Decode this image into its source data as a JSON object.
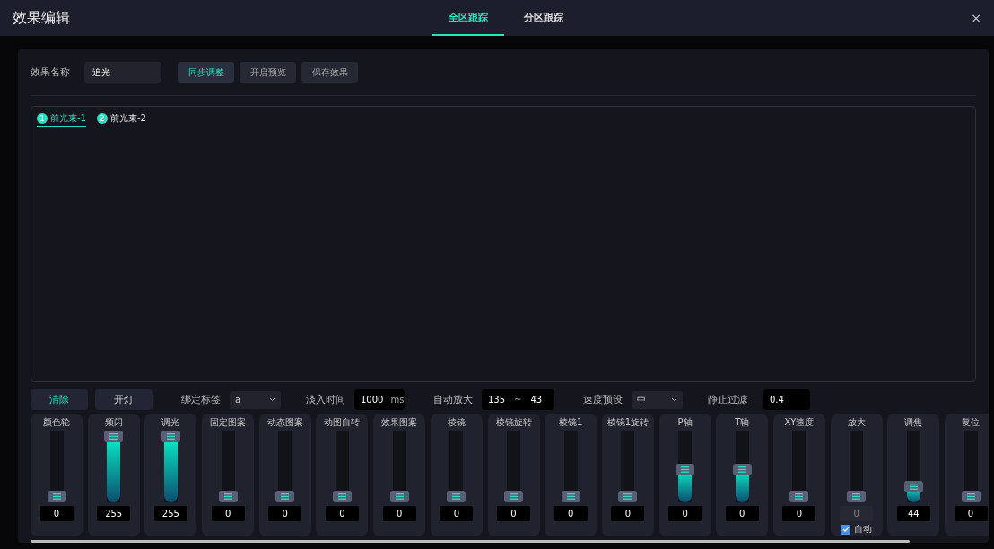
{
  "window": {
    "title": "效果编辑",
    "close": "×"
  },
  "tabs": [
    {
      "label": "全区跟踪",
      "selected": true
    },
    {
      "label": "分区跟踪",
      "selected": false
    }
  ],
  "effect_name": {
    "label": "效果名称",
    "value": "追光"
  },
  "header_buttons": [
    {
      "label": "同步调整",
      "selected": true
    },
    {
      "label": "开启预览",
      "selected": false
    },
    {
      "label": "保存效果",
      "selected": false
    }
  ],
  "fixtures": [
    {
      "number": "1",
      "label": "前光束-1",
      "selected": true
    },
    {
      "number": "2",
      "label": "前光束-2",
      "selected": false
    }
  ],
  "controls": {
    "clear": "清除",
    "light_on": "开灯",
    "bind_label": "绑定标签",
    "bind_value": "a",
    "fade_label": "淡入时间",
    "fade_value": "1000",
    "fade_unit": "ms",
    "auto_zoom_label": "自动放大",
    "auto_zoom_from": "135",
    "auto_zoom_sep": "~",
    "auto_zoom_to": "43",
    "speed_label": "速度预设",
    "speed_value": "中",
    "still_label": "静止过滤",
    "still_value": "0.4"
  },
  "faders": [
    {
      "label": "颜色轮",
      "level": 0,
      "value": "0",
      "disabled": false
    },
    {
      "label": "频闪",
      "level": 1,
      "value": "255",
      "disabled": false
    },
    {
      "label": "调光",
      "level": 1,
      "value": "255",
      "disabled": false
    },
    {
      "label": "固定图案",
      "level": 0,
      "value": "0",
      "disabled": false
    },
    {
      "label": "动态图案",
      "level": 0,
      "value": "0",
      "disabled": false
    },
    {
      "label": "动图自转",
      "level": 0,
      "value": "0",
      "disabled": false
    },
    {
      "label": "效果图案",
      "level": 0,
      "value": "0",
      "disabled": false
    },
    {
      "label": "棱镜",
      "level": 0,
      "value": "0",
      "disabled": false
    },
    {
      "label": "棱镜旋转",
      "level": 0,
      "value": "0",
      "disabled": false
    },
    {
      "label": "棱镜1",
      "level": 0,
      "value": "0",
      "disabled": false
    },
    {
      "label": "棱镜1旋转",
      "level": 0,
      "value": "0",
      "disabled": false
    },
    {
      "label": "P轴",
      "level": 0.45,
      "value": "0",
      "disabled": false
    },
    {
      "label": "T轴",
      "level": 0.45,
      "value": "0",
      "disabled": false
    },
    {
      "label": "XY速度",
      "level": 0,
      "value": "0",
      "disabled": false
    },
    {
      "label": "放大",
      "level": 0,
      "value": "0",
      "disabled": true,
      "auto": {
        "label": "自动",
        "checked": true
      }
    },
    {
      "label": "调焦",
      "level": 0.17,
      "value": "44",
      "disabled": false
    },
    {
      "label": "复位",
      "level": 0,
      "value": "0",
      "disabled": false
    }
  ]
}
